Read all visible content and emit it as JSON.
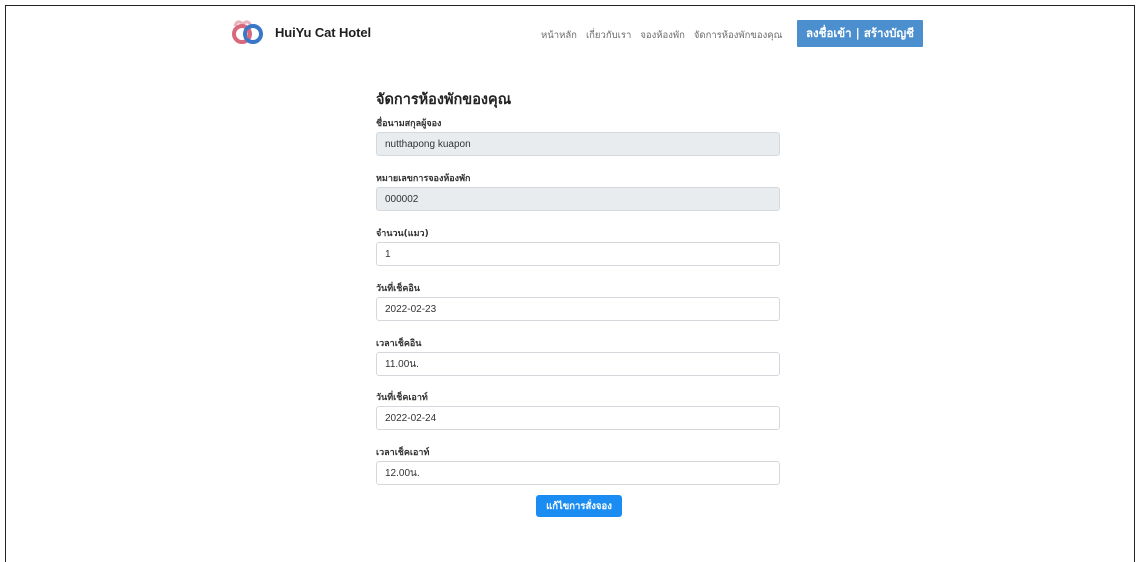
{
  "brand": {
    "name": "HuiYu Cat Hotel",
    "logo_icon": "cat-hotel-logo-icon",
    "logo_colors": [
      "#d9697a",
      "#3b77c9",
      "#e8b3bc"
    ]
  },
  "nav": {
    "links": [
      "หน้าหลัก",
      "เกี่ยวกับเรา",
      "จองห้องพัก",
      "จัดการห้องพักของคุณ"
    ],
    "login_label": "ลงชื่อเข้า | สร้างบัญชี",
    "login_color": "#4c8fcf"
  },
  "form": {
    "title": "จัดการห้องพักของคุณ",
    "fields": [
      {
        "label": "ชื่อนามสกุลผู้จอง",
        "value": "nutthapong kuapon",
        "readonly": true
      },
      {
        "label": "หมายเลขการจองห้องพัก",
        "value": "000002",
        "readonly": true
      },
      {
        "label": "จำนวน(แมว)",
        "value": "1",
        "readonly": false
      },
      {
        "label": "วันที่เช็คอิน",
        "value": "2022-02-23",
        "readonly": false
      },
      {
        "label": "เวลาเช็คอิน",
        "value": "11.00น.",
        "readonly": false
      },
      {
        "label": "วันที่เช็คเอาท์",
        "value": "2022-02-24",
        "readonly": false
      },
      {
        "label": "เวลาเช็คเอาท์",
        "value": "12.00น.",
        "readonly": false
      }
    ],
    "submit_label": "แก้ไขการสั่งจอง",
    "submit_color": "#1a8cf2"
  }
}
